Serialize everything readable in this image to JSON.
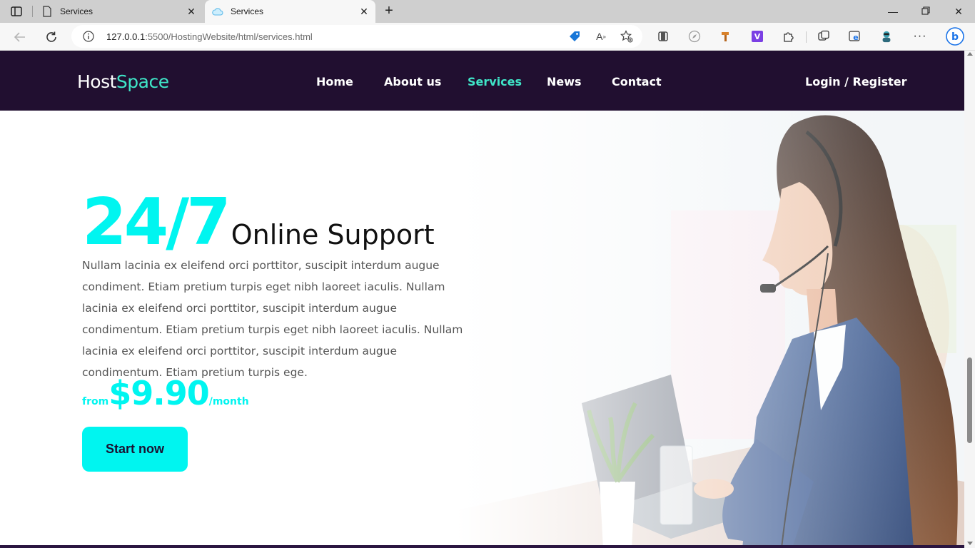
{
  "browser": {
    "tabs": [
      {
        "title": "Services",
        "active": false
      },
      {
        "title": "Services",
        "active": true
      }
    ],
    "address": {
      "host": "127.0.0.1",
      "path": ":5500/HostingWebsite/html/services.html"
    }
  },
  "site": {
    "logo": {
      "part1": "Host",
      "part2": "Space"
    },
    "nav": [
      "Home",
      "About us",
      "Services",
      "News",
      "Contact"
    ],
    "active_nav": "Services",
    "login": "Login / Register",
    "hero": {
      "big": "24/7",
      "title": "Online Support",
      "text": "Nullam lacinia ex eleifend orci porttitor, suscipit interdum augue condiment. Etiam pretium turpis eget nibh laoreet iaculis. Nullam lacinia ex eleifend orci porttitor, suscipit interdum augue condimentum. Etiam pretium turpis eget nibh laoreet iaculis. Nullam lacinia ex eleifend orci porttitor, suscipit interdum augue condimentum. Etiam pretium turpis ege.",
      "price_prefix": "from",
      "price": "$9.90",
      "price_suffix": "/month",
      "cta": "Start now"
    }
  },
  "colors": {
    "header_bg": "#210f30",
    "accent_cyan": "#00f5f0",
    "accent_teal": "#3fe6c8"
  }
}
